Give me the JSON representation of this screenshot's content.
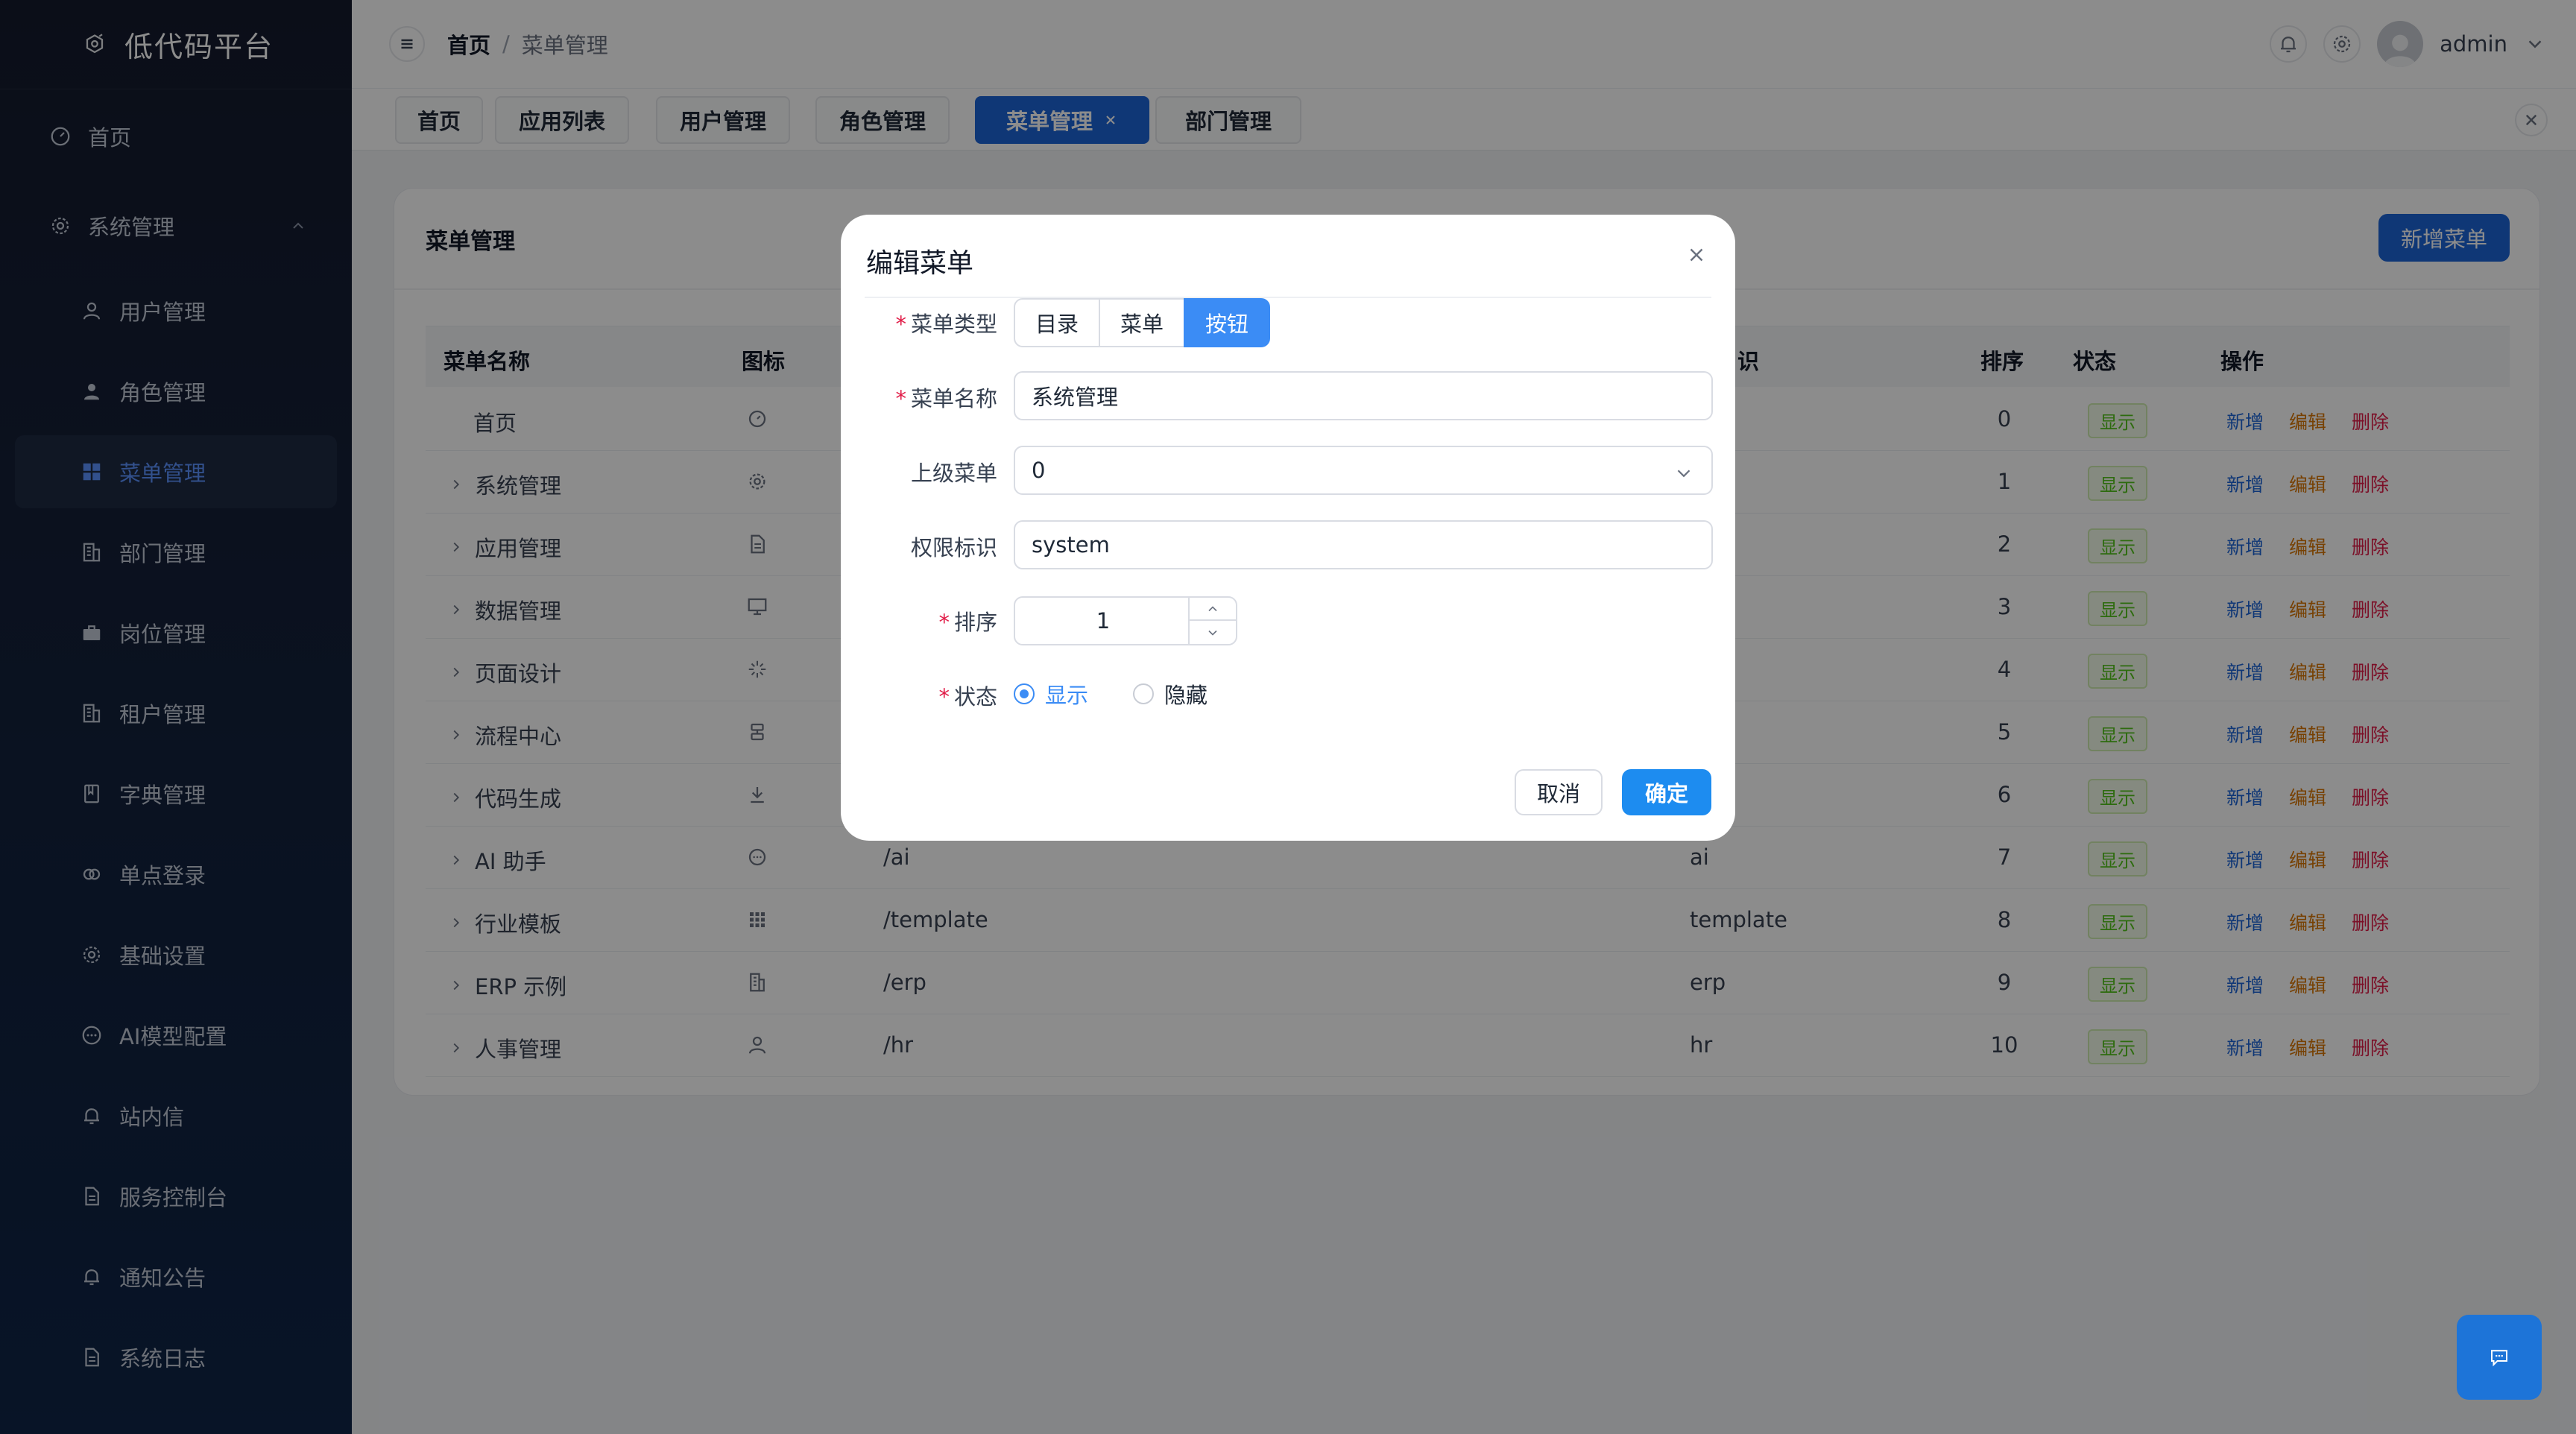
{
  "app": {
    "title": "低代码平台"
  },
  "sidebar": {
    "top": [
      {
        "label": "首页",
        "icon": "dashboard-icon"
      },
      {
        "label": "系统管理",
        "icon": "gear-icon"
      }
    ],
    "items": [
      {
        "label": "用户管理",
        "icon": "user-icon"
      },
      {
        "label": "角色管理",
        "icon": "user-solid-icon"
      },
      {
        "label": "菜单管理",
        "icon": "grid-icon"
      },
      {
        "label": "部门管理",
        "icon": "building-icon"
      },
      {
        "label": "岗位管理",
        "icon": "briefcase-icon"
      },
      {
        "label": "租户管理",
        "icon": "building-icon"
      },
      {
        "label": "字典管理",
        "icon": "book-icon"
      },
      {
        "label": "单点登录",
        "icon": "link-icon"
      },
      {
        "label": "基础设置",
        "icon": "gear-icon"
      },
      {
        "label": "AI模型配置",
        "icon": "chat-icon"
      },
      {
        "label": "站内信",
        "icon": "bell-icon"
      },
      {
        "label": "服务控制台",
        "icon": "document-icon"
      },
      {
        "label": "通知公告",
        "icon": "bell-icon"
      },
      {
        "label": "系统日志",
        "icon": "document-icon"
      }
    ]
  },
  "header": {
    "breadcrumb": [
      "首页",
      "菜单管理"
    ],
    "username": "admin"
  },
  "tabs": [
    {
      "label": "首页"
    },
    {
      "label": "应用列表"
    },
    {
      "label": "用户管理"
    },
    {
      "label": "角色管理"
    },
    {
      "label": "菜单管理",
      "active": true
    },
    {
      "label": "部门管理"
    }
  ],
  "card": {
    "title": "菜单管理",
    "add_button": "新增菜单"
  },
  "table": {
    "headers": {
      "name": "菜单名称",
      "icon": "图标",
      "perm_partial": "识",
      "sort": "排序",
      "status": "状态",
      "actions": "操作"
    },
    "rows": [
      {
        "name": "首页",
        "expand": false,
        "path": "",
        "perm": "ard",
        "sort": "0",
        "status": "显示",
        "icon": "dashboard-icon"
      },
      {
        "name": "系统管理",
        "expand": true,
        "path": "",
        "perm": "",
        "sort": "1",
        "status": "显示",
        "icon": "gear-icon"
      },
      {
        "name": "应用管理",
        "expand": true,
        "path": "",
        "perm": "tion",
        "sort": "2",
        "status": "显示",
        "icon": "document-icon"
      },
      {
        "name": "数据管理",
        "expand": true,
        "path": "",
        "perm": "se",
        "sort": "3",
        "status": "显示",
        "icon": "monitor-icon"
      },
      {
        "name": "页面设计",
        "expand": true,
        "path": "",
        "perm": "er",
        "sort": "4",
        "status": "显示",
        "icon": "sparkle-icon"
      },
      {
        "name": "流程中心",
        "expand": true,
        "path": "",
        "perm": "",
        "sort": "5",
        "status": "显示",
        "icon": "flow-icon"
      },
      {
        "name": "代码生成",
        "expand": true,
        "path": "",
        "perm": "or",
        "sort": "6",
        "status": "显示",
        "icon": "download-icon"
      },
      {
        "name": "AI 助手",
        "expand": true,
        "path": "/ai",
        "perm": "ai",
        "sort": "7",
        "status": "显示",
        "icon": "chat-icon"
      },
      {
        "name": "行业模板",
        "expand": true,
        "path": "/template",
        "perm": "template",
        "sort": "8",
        "status": "显示",
        "icon": "grid-icon"
      },
      {
        "name": "ERP 示例",
        "expand": true,
        "path": "/erp",
        "perm": "erp",
        "sort": "9",
        "status": "显示",
        "icon": "building-icon"
      },
      {
        "name": "人事管理",
        "expand": true,
        "path": "/hr",
        "perm": "hr",
        "sort": "10",
        "status": "显示",
        "icon": "user-icon"
      }
    ],
    "actions": {
      "add": "新增",
      "edit": "编辑",
      "delete": "删除"
    }
  },
  "modal": {
    "title": "编辑菜单",
    "labels": {
      "type": "菜单类型",
      "name": "菜单名称",
      "parent": "上级菜单",
      "perm": "权限标识",
      "sort": "排序",
      "status": "状态"
    },
    "type_options": [
      "目录",
      "菜单",
      "按钮"
    ],
    "type_selected": "按钮",
    "name_value": "系统管理",
    "parent_value": "0",
    "perm_value": "system",
    "sort_value": "1",
    "status_options": [
      "显示",
      "隐藏"
    ],
    "status_selected": "显示",
    "cancel": "取消",
    "ok": "确定"
  },
  "colors": {
    "primary": "#1d64d8",
    "accent": "#3b8cf5",
    "success": "#52c41a",
    "warning": "#d97706",
    "danger": "#e11d48",
    "sidebar_bg": "#142039"
  }
}
